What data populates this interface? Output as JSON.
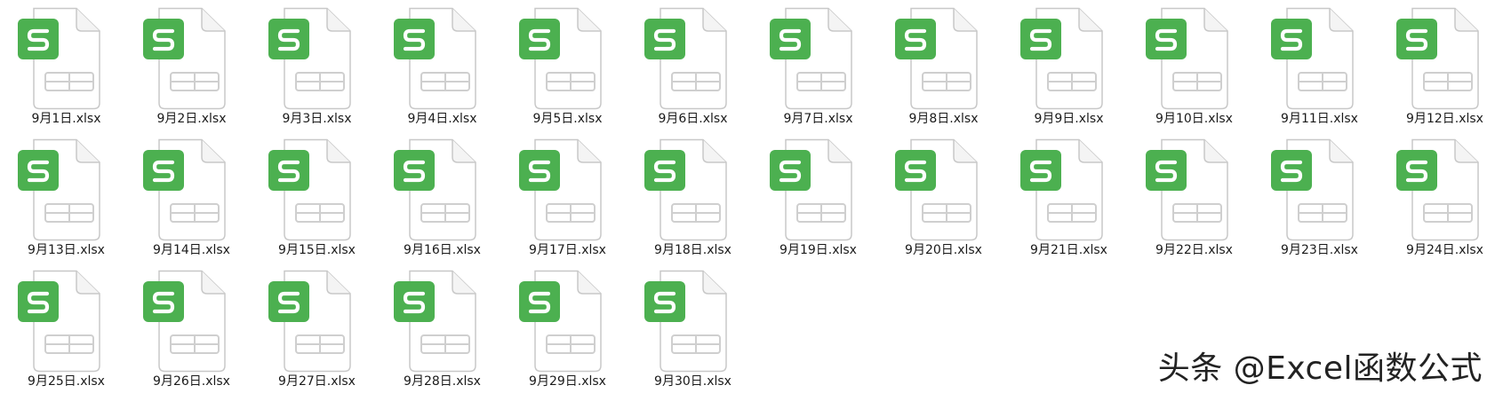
{
  "folder": {
    "files": [
      {
        "name": "9月1日.xlsx",
        "icon": "spreadsheet-file-icon"
      },
      {
        "name": "9月2日.xlsx",
        "icon": "spreadsheet-file-icon"
      },
      {
        "name": "9月3日.xlsx",
        "icon": "spreadsheet-file-icon"
      },
      {
        "name": "9月4日.xlsx",
        "icon": "spreadsheet-file-icon"
      },
      {
        "name": "9月5日.xlsx",
        "icon": "spreadsheet-file-icon"
      },
      {
        "name": "9月6日.xlsx",
        "icon": "spreadsheet-file-icon"
      },
      {
        "name": "9月7日.xlsx",
        "icon": "spreadsheet-file-icon"
      },
      {
        "name": "9月8日.xlsx",
        "icon": "spreadsheet-file-icon"
      },
      {
        "name": "9月9日.xlsx",
        "icon": "spreadsheet-file-icon"
      },
      {
        "name": "9月10日.xlsx",
        "icon": "spreadsheet-file-icon"
      },
      {
        "name": "9月11日.xlsx",
        "icon": "spreadsheet-file-icon"
      },
      {
        "name": "9月12日.xlsx",
        "icon": "spreadsheet-file-icon"
      },
      {
        "name": "9月13日.xlsx",
        "icon": "spreadsheet-file-icon"
      },
      {
        "name": "9月14日.xlsx",
        "icon": "spreadsheet-file-icon"
      },
      {
        "name": "9月15日.xlsx",
        "icon": "spreadsheet-file-icon"
      },
      {
        "name": "9月16日.xlsx",
        "icon": "spreadsheet-file-icon"
      },
      {
        "name": "9月17日.xlsx",
        "icon": "spreadsheet-file-icon"
      },
      {
        "name": "9月18日.xlsx",
        "icon": "spreadsheet-file-icon"
      },
      {
        "name": "9月19日.xlsx",
        "icon": "spreadsheet-file-icon"
      },
      {
        "name": "9月20日.xlsx",
        "icon": "spreadsheet-file-icon"
      },
      {
        "name": "9月21日.xlsx",
        "icon": "spreadsheet-file-icon"
      },
      {
        "name": "9月22日.xlsx",
        "icon": "spreadsheet-file-icon"
      },
      {
        "name": "9月23日.xlsx",
        "icon": "spreadsheet-file-icon"
      },
      {
        "name": "9月24日.xlsx",
        "icon": "spreadsheet-file-icon"
      },
      {
        "name": "9月25日.xlsx",
        "icon": "spreadsheet-file-icon"
      },
      {
        "name": "9月26日.xlsx",
        "icon": "spreadsheet-file-icon"
      },
      {
        "name": "9月27日.xlsx",
        "icon": "spreadsheet-file-icon"
      },
      {
        "name": "9月28日.xlsx",
        "icon": "spreadsheet-file-icon"
      },
      {
        "name": "9月29日.xlsx",
        "icon": "spreadsheet-file-icon"
      },
      {
        "name": "9月30日.xlsx",
        "icon": "spreadsheet-file-icon"
      }
    ],
    "icon_glyph": "S"
  },
  "watermark": {
    "text": "头条 @Excel函数公式"
  },
  "colors": {
    "badge_green": "#4cb050",
    "page_fill": "#ffffff",
    "page_stroke": "#c8c8c8",
    "table_stroke": "#cfcfcf",
    "label_text": "#1a1a1a"
  }
}
